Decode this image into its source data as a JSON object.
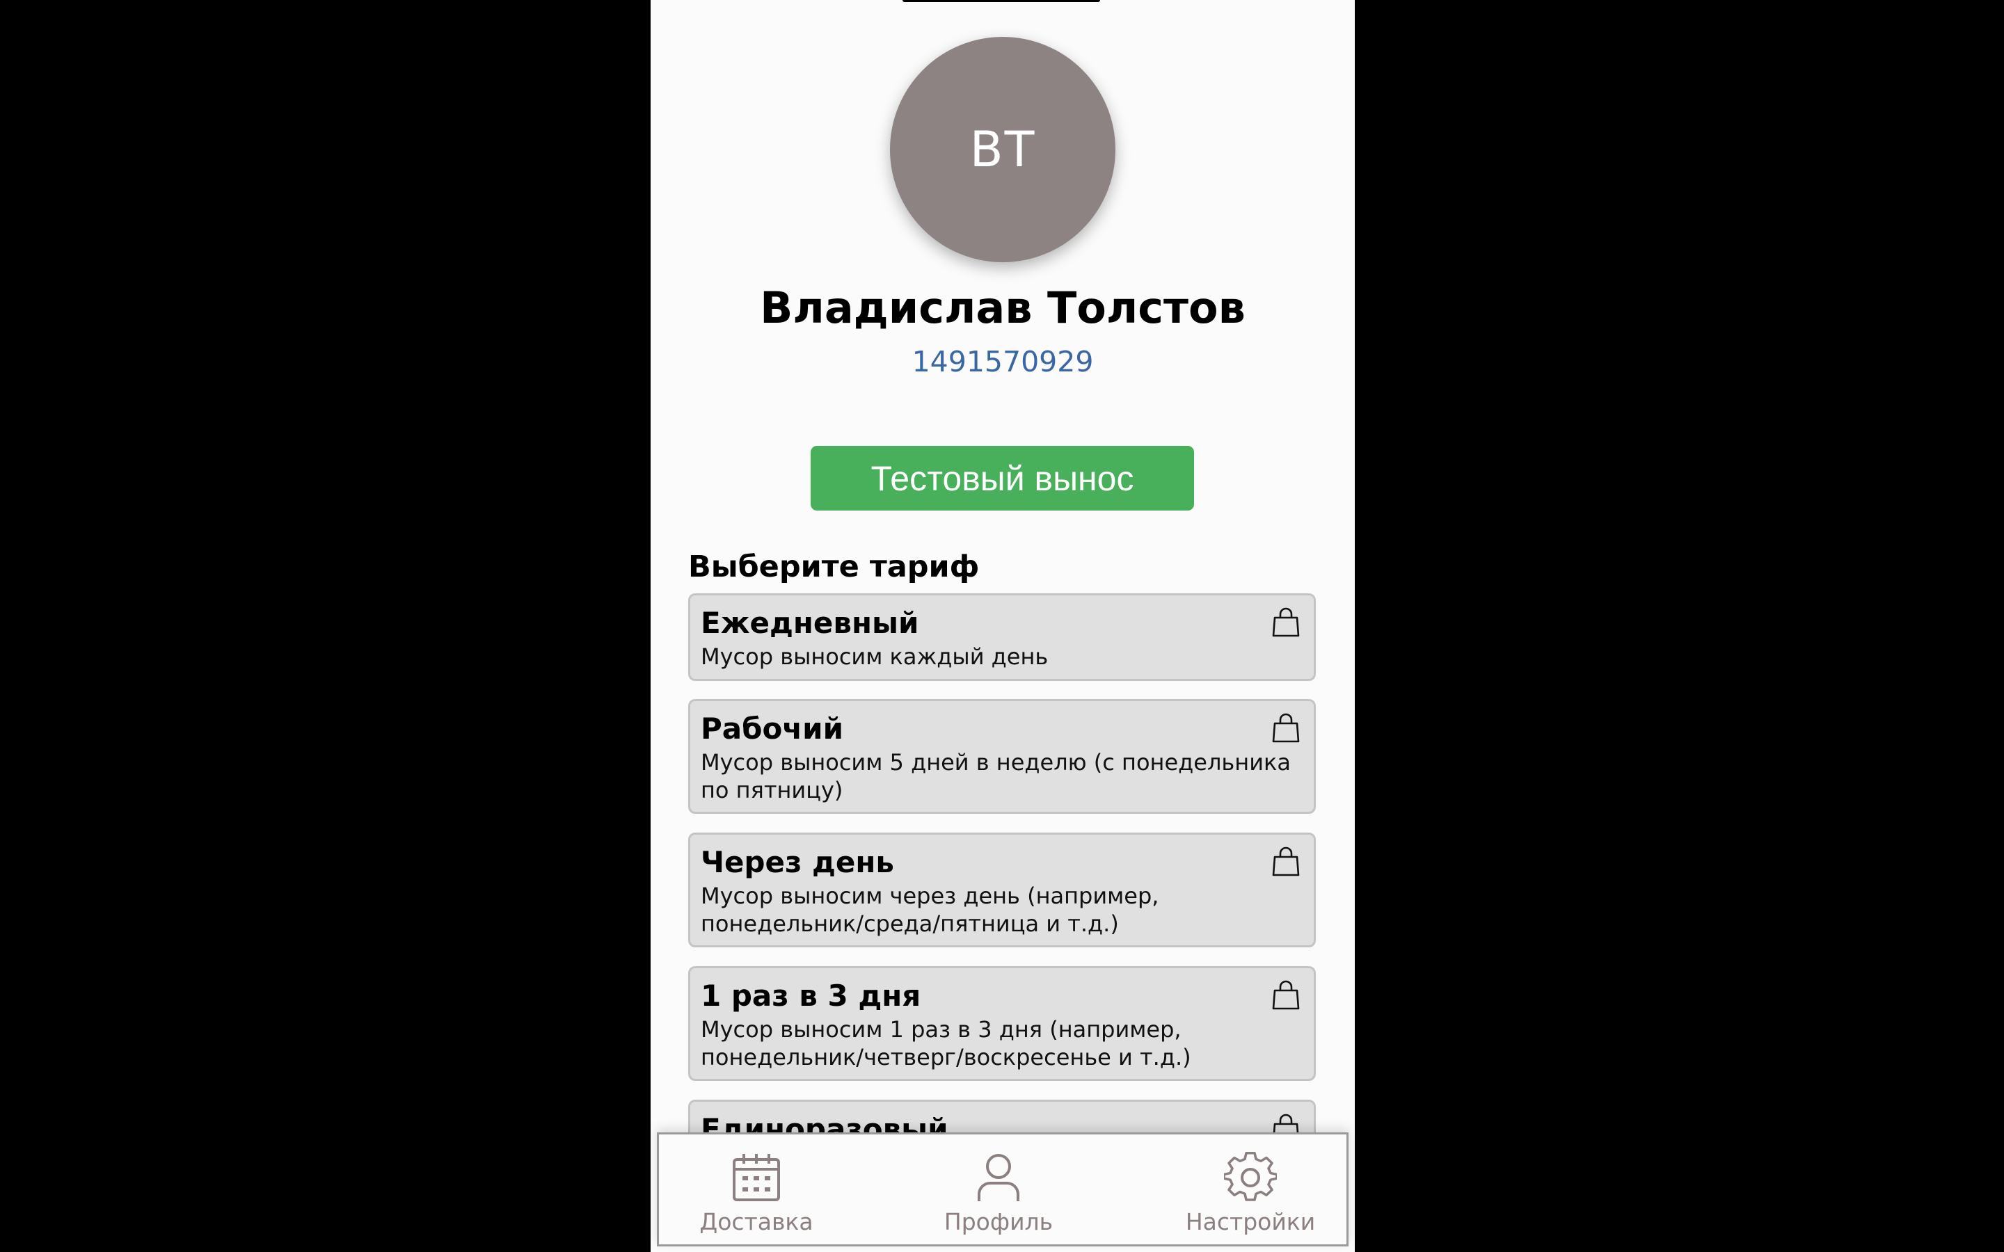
{
  "profile": {
    "initials": "ВТ",
    "name": "Владислав Толстов",
    "id": "1491570929"
  },
  "actions": {
    "test_button_label": "Тестовый вынос"
  },
  "tariffs": {
    "heading": "Выберите тариф",
    "items": [
      {
        "title": "Ежедневный",
        "description": "Мусор выносим каждый день",
        "icon": "shopping-bag-icon"
      },
      {
        "title": "Рабочий",
        "description": "Мусор выносим 5 дней в неделю (с понедельника по пятницу)",
        "icon": "shopping-bag-icon"
      },
      {
        "title": "Через день",
        "description": "Мусор выносим через день (например, понедельник/среда/пятница и т.д.)",
        "icon": "shopping-bag-icon"
      },
      {
        "title": "1 раз в 3 дня",
        "description": "Мусор выносим 1 раз в 3 дня (например, понедельник/четверг/воскресенье и т.д.)",
        "icon": "shopping-bag-icon"
      },
      {
        "title": "Единоразовый",
        "description": "",
        "icon": "shopping-bag-icon"
      }
    ]
  },
  "bottom_nav": {
    "items": [
      {
        "label": "Доставка",
        "icon": "calendar-icon"
      },
      {
        "label": "Профиль",
        "icon": "user-icon"
      },
      {
        "label": "Настройки",
        "icon": "gear-icon"
      }
    ]
  },
  "colors": {
    "avatar_bg": "#8e8383",
    "accent_green": "#48b05a",
    "id_link": "#3a67a3",
    "card_bg": "#e0e0e0",
    "nav_text": "#8b7f7f"
  }
}
